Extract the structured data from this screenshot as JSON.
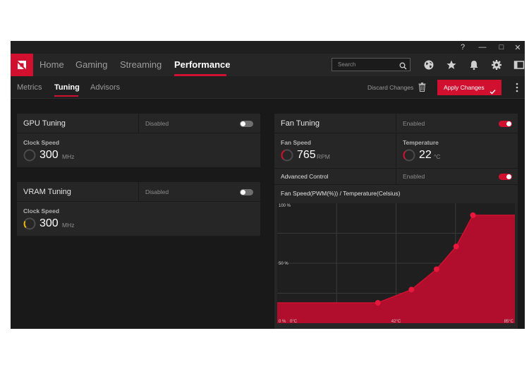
{
  "window": {
    "controls": [
      {
        "name": "help-button",
        "glyph": "?"
      },
      {
        "name": "minimize-button",
        "glyph": "—"
      },
      {
        "name": "maximize-button",
        "glyph": "□"
      },
      {
        "name": "close-button",
        "glyph": "✕"
      }
    ]
  },
  "nav": {
    "tabs": [
      {
        "label": "Home",
        "active": false
      },
      {
        "label": "Gaming",
        "active": false
      },
      {
        "label": "Streaming",
        "active": false
      },
      {
        "label": "Performance",
        "active": true
      }
    ],
    "search_placeholder": "Search",
    "icons": [
      "globe-icon",
      "star-icon",
      "bell-icon",
      "gear-icon",
      "sidebar-toggle-icon"
    ]
  },
  "subnav": {
    "tabs": [
      {
        "label": "Metrics",
        "active": false
      },
      {
        "label": "Tuning",
        "active": true
      },
      {
        "label": "Advisors",
        "active": false
      }
    ],
    "discard_label": "Discard Changes",
    "apply_label": "Apply Changes"
  },
  "gpu_tuning": {
    "title": "GPU Tuning",
    "state": "Disabled",
    "enabled": false,
    "clock_label": "Clock Speed",
    "clock_value": "300",
    "clock_unit": "MHz"
  },
  "vram_tuning": {
    "title": "VRAM Tuning",
    "state": "Disabled",
    "enabled": false,
    "clock_label": "Clock Speed",
    "clock_value": "300",
    "clock_unit": "MHz"
  },
  "fan_tuning": {
    "title": "Fan Tuning",
    "state": "Enabled",
    "enabled": true,
    "fan_speed_label": "Fan Speed",
    "fan_speed_value": "765",
    "fan_speed_unit": "RPM",
    "temperature_label": "Temperature",
    "temperature_value": "22",
    "temperature_unit": "°C",
    "advanced_label": "Advanced Control",
    "advanced_state": "Enabled",
    "advanced_enabled": true,
    "curve_title": "Fan Speed(PWM(%)) / Temperature(Celsius)"
  },
  "colors": {
    "accent": "#d1102f",
    "background": "#19191a",
    "panel": "#262627"
  },
  "chart_data": {
    "type": "area",
    "title": "Fan Speed(PWM(%)) / Temperature(Celsius)",
    "xlabel": "",
    "ylabel": "",
    "xlim": [
      0,
      85
    ],
    "ylim": [
      0,
      100
    ],
    "y_tick_labels": [
      "100 %",
      "50 %",
      "0 %"
    ],
    "x_tick_labels": [
      "0°C",
      "42°C",
      "85°C"
    ],
    "grid": true,
    "series": [
      {
        "x": [
          0,
          36,
          48,
          57,
          64,
          70,
          85
        ],
        "y": [
          17,
          17,
          28,
          45,
          64,
          90,
          90
        ],
        "points": [
          {
            "x": 36,
            "y": 17
          },
          {
            "x": 48,
            "y": 28
          },
          {
            "x": 57,
            "y": 45
          },
          {
            "x": 64,
            "y": 64
          },
          {
            "x": 70,
            "y": 90
          }
        ]
      }
    ]
  }
}
